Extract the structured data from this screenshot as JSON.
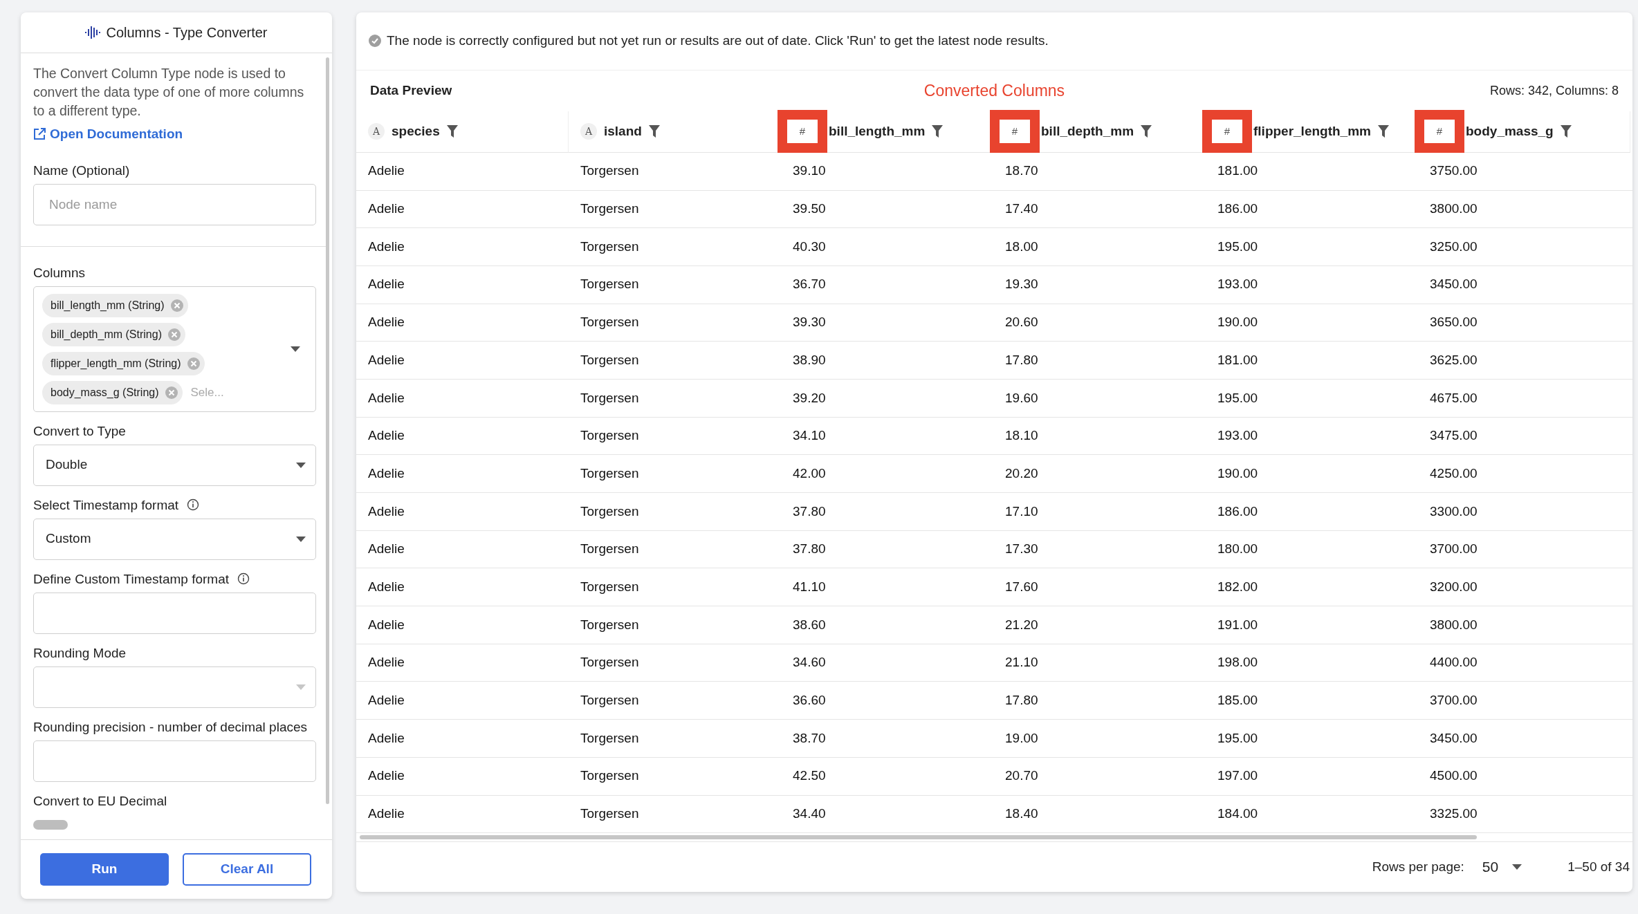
{
  "panel": {
    "title": "Columns - Type Converter",
    "description": "The Convert Column Type node is used to convert the data type of one of more columns to a different type.",
    "doc_link": "Open Documentation",
    "fields": [
      {
        "kind": "input",
        "label": "Name (Optional)",
        "placeholder": "Node name",
        "divider_after": true
      },
      {
        "kind": "multiselect",
        "label": "Columns",
        "chips": [
          "bill_length_mm (String)",
          "bill_depth_mm (String)",
          "flipper_length_mm (String)",
          "body_mass_g (String)"
        ],
        "placeholder": "Sele..."
      },
      {
        "kind": "select",
        "label": "Convert to Type",
        "value": "Double"
      },
      {
        "kind": "select",
        "label": "Select Timestamp format",
        "info": true,
        "value": "Custom"
      },
      {
        "kind": "input",
        "label": "Define Custom Timestamp format",
        "info": true
      },
      {
        "kind": "select",
        "label": "Rounding Mode",
        "disabled": true
      },
      {
        "kind": "input",
        "label": "Rounding precision - number of decimal places"
      },
      {
        "kind": "toggle",
        "label": "Convert to EU Decimal",
        "on": false
      }
    ],
    "buttons": [
      {
        "label": "Run",
        "kind": "primary"
      },
      {
        "label": "Clear All",
        "kind": "outline"
      }
    ]
  },
  "banner": "The node is correctly configured but not yet run or results are out of date. Click 'Run' to get the latest node results.",
  "preview": {
    "title": "Data Preview",
    "annotation": "Converted Columns",
    "summary": "Rows: 342, Columns: 8",
    "columns": [
      {
        "name": "species",
        "type": "A",
        "highlighted": false
      },
      {
        "name": "island",
        "type": "A",
        "highlighted": false
      },
      {
        "name": "bill_length_mm",
        "type": "#",
        "highlighted": true
      },
      {
        "name": "bill_depth_mm",
        "type": "#",
        "highlighted": true
      },
      {
        "name": "flipper_length_mm",
        "type": "#",
        "highlighted": true
      },
      {
        "name": "body_mass_g",
        "type": "#",
        "highlighted": true
      }
    ],
    "rows": [
      [
        "Adelie",
        "Torgersen",
        "39.10",
        "18.70",
        "181.00",
        "3750.00"
      ],
      [
        "Adelie",
        "Torgersen",
        "39.50",
        "17.40",
        "186.00",
        "3800.00"
      ],
      [
        "Adelie",
        "Torgersen",
        "40.30",
        "18.00",
        "195.00",
        "3250.00"
      ],
      [
        "Adelie",
        "Torgersen",
        "36.70",
        "19.30",
        "193.00",
        "3450.00"
      ],
      [
        "Adelie",
        "Torgersen",
        "39.30",
        "20.60",
        "190.00",
        "3650.00"
      ],
      [
        "Adelie",
        "Torgersen",
        "38.90",
        "17.80",
        "181.00",
        "3625.00"
      ],
      [
        "Adelie",
        "Torgersen",
        "39.20",
        "19.60",
        "195.00",
        "4675.00"
      ],
      [
        "Adelie",
        "Torgersen",
        "34.10",
        "18.10",
        "193.00",
        "3475.00"
      ],
      [
        "Adelie",
        "Torgersen",
        "42.00",
        "20.20",
        "190.00",
        "4250.00"
      ],
      [
        "Adelie",
        "Torgersen",
        "37.80",
        "17.10",
        "186.00",
        "3300.00"
      ],
      [
        "Adelie",
        "Torgersen",
        "37.80",
        "17.30",
        "180.00",
        "3700.00"
      ],
      [
        "Adelie",
        "Torgersen",
        "41.10",
        "17.60",
        "182.00",
        "3200.00"
      ],
      [
        "Adelie",
        "Torgersen",
        "38.60",
        "21.20",
        "191.00",
        "3800.00"
      ],
      [
        "Adelie",
        "Torgersen",
        "34.60",
        "21.10",
        "198.00",
        "4400.00"
      ],
      [
        "Adelie",
        "Torgersen",
        "36.60",
        "17.80",
        "185.00",
        "3700.00"
      ],
      [
        "Adelie",
        "Torgersen",
        "38.70",
        "19.00",
        "195.00",
        "3450.00"
      ],
      [
        "Adelie",
        "Torgersen",
        "42.50",
        "20.70",
        "197.00",
        "4500.00"
      ],
      [
        "Adelie",
        "Torgersen",
        "34.40",
        "18.40",
        "184.00",
        "3325.00"
      ]
    ],
    "rows_per_page_label": "Rows per page:",
    "rows_per_page": "50",
    "range": "1–50 of 34"
  }
}
